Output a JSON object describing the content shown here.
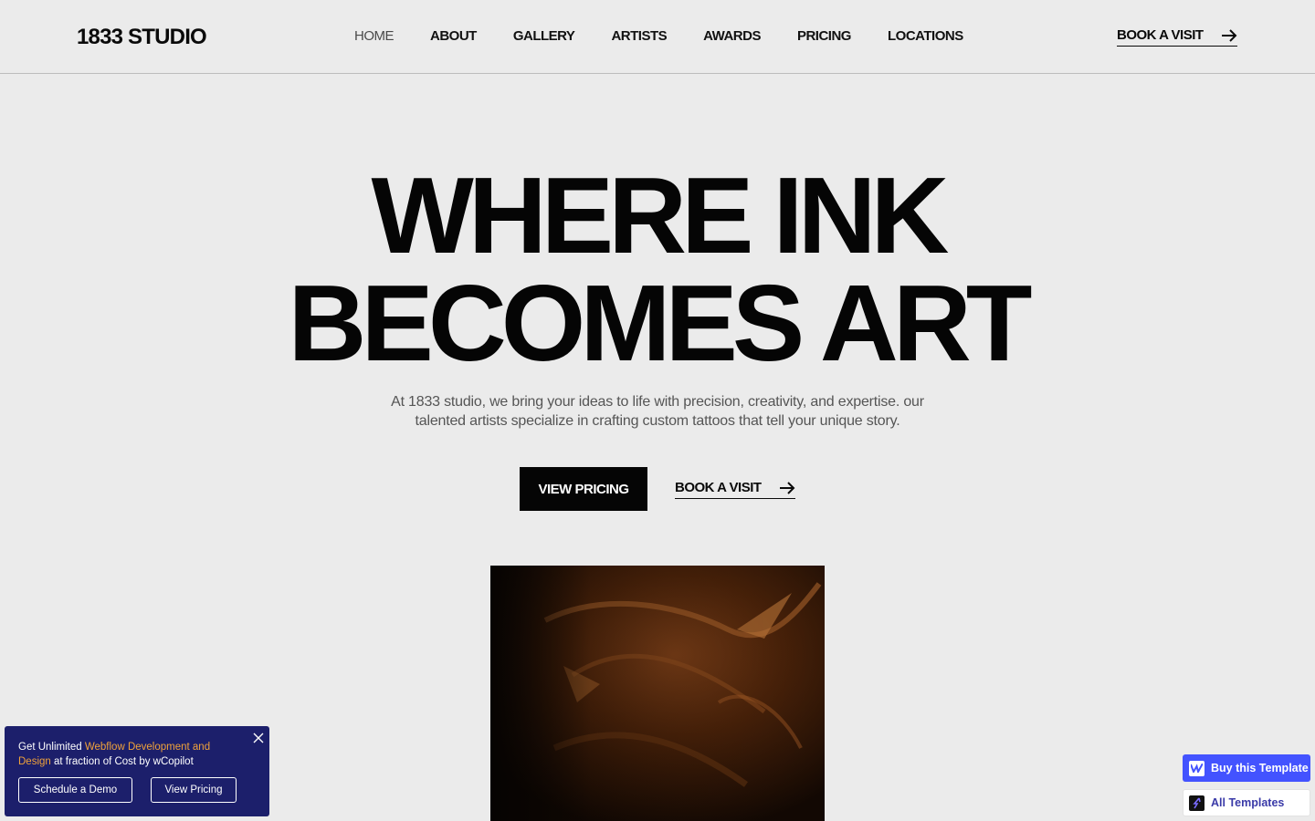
{
  "brand": "1833 STUDIO",
  "nav": {
    "items": [
      {
        "label": "HOME",
        "active": true
      },
      {
        "label": "ABOUT"
      },
      {
        "label": "GALLERY"
      },
      {
        "label": "ARTISTS"
      },
      {
        "label": "AWARDS"
      },
      {
        "label": "PRICING"
      },
      {
        "label": "LOCATIONS"
      }
    ],
    "cta_label": "BOOK A VISIT"
  },
  "hero": {
    "title_line1": "WHERE INK",
    "title_line2": "BECOMES ART",
    "subtitle": "At 1833 studio, we bring your ideas to life with precision, creativity, and expertise. our talented artists specialize in crafting custom tattoos that tell your unique story.",
    "primary_label": "VIEW PRICING",
    "secondary_label": "BOOK A VISIT"
  },
  "promo": {
    "text_before": "Get Unlimited ",
    "text_highlight": "Webflow Development and Design",
    "text_after": " at fraction of Cost by wCopilot",
    "demo_label": "Schedule a Demo",
    "pricing_label": "View Pricing"
  },
  "template_buttons": {
    "buy_label": "Buy this Template",
    "all_label": "All Templates"
  },
  "colors": {
    "background": "#ebebeb",
    "text": "#0a0a0a",
    "promo_bg": "#1c1f6b",
    "promo_highlight": "#f0a23a",
    "buy_bg": "#4353ff"
  },
  "icons": {
    "arrow": "arrow-right-icon",
    "close": "close-icon",
    "webflow": "webflow-logo-icon",
    "templates": "templates-logo-icon"
  }
}
